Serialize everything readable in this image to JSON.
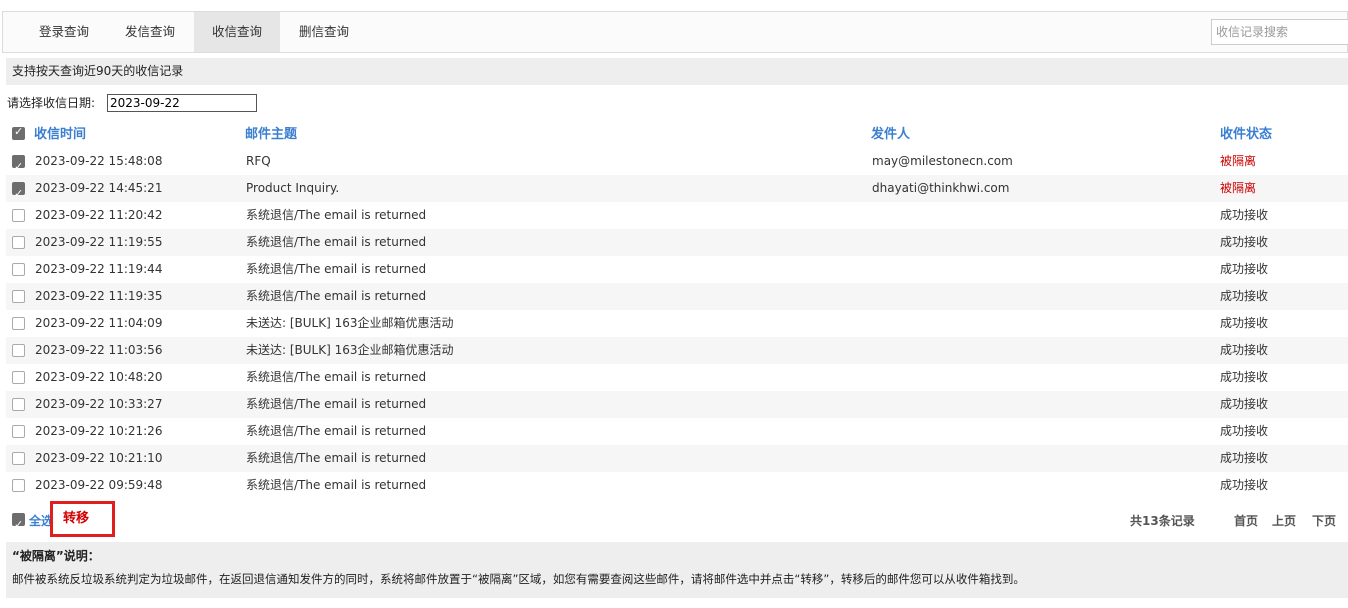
{
  "tabs": [
    {
      "label": "登录查询",
      "active": false
    },
    {
      "label": "发信查询",
      "active": false
    },
    {
      "label": "收信查询",
      "active": true
    },
    {
      "label": "删信查询",
      "active": false
    }
  ],
  "search": {
    "placeholder": "收信记录搜索"
  },
  "info": "支持按天查询近90天的收信记录",
  "date_filter": {
    "label": "请选择收信日期:",
    "value": "2023-09-22"
  },
  "table": {
    "headers": {
      "time": "收信时间",
      "subject": "邮件主题",
      "sender": "发件人",
      "status": "收件状态"
    },
    "rows": [
      {
        "checked": true,
        "time": "2023-09-22 15:48:08",
        "subject": "RFQ",
        "sender": "may@milestonecn.com",
        "status": "被隔离",
        "quarantined": true
      },
      {
        "checked": true,
        "time": "2023-09-22 14:45:21",
        "subject": "Product Inquiry.",
        "sender": "dhayati@thinkhwi.com",
        "status": "被隔离",
        "quarantined": true
      },
      {
        "checked": false,
        "time": "2023-09-22 11:20:42",
        "subject": "系统退信/The email is returned",
        "sender": "",
        "status": "成功接收",
        "quarantined": false
      },
      {
        "checked": false,
        "time": "2023-09-22 11:19:55",
        "subject": "系统退信/The email is returned",
        "sender": "",
        "status": "成功接收",
        "quarantined": false
      },
      {
        "checked": false,
        "time": "2023-09-22 11:19:44",
        "subject": "系统退信/The email is returned",
        "sender": "",
        "status": "成功接收",
        "quarantined": false
      },
      {
        "checked": false,
        "time": "2023-09-22 11:19:35",
        "subject": "系统退信/The email is returned",
        "sender": "",
        "status": "成功接收",
        "quarantined": false
      },
      {
        "checked": false,
        "time": "2023-09-22 11:04:09",
        "subject": "未送达: [BULK] 163企业邮箱优惠活动",
        "sender": "",
        "status": "成功接收",
        "quarantined": false
      },
      {
        "checked": false,
        "time": "2023-09-22 11:03:56",
        "subject": "未送达: [BULK] 163企业邮箱优惠活动",
        "sender": "",
        "status": "成功接收",
        "quarantined": false
      },
      {
        "checked": false,
        "time": "2023-09-22 10:48:20",
        "subject": "系统退信/The email is returned",
        "sender": "",
        "status": "成功接收",
        "quarantined": false
      },
      {
        "checked": false,
        "time": "2023-09-22 10:33:27",
        "subject": "系统退信/The email is returned",
        "sender": "",
        "status": "成功接收",
        "quarantined": false
      },
      {
        "checked": false,
        "time": "2023-09-22 10:21:26",
        "subject": "系统退信/The email is returned",
        "sender": "",
        "status": "成功接收",
        "quarantined": false
      },
      {
        "checked": false,
        "time": "2023-09-22 10:21:10",
        "subject": "系统退信/The email is returned",
        "sender": "",
        "status": "成功接收",
        "quarantined": false
      },
      {
        "checked": false,
        "time": "2023-09-22 09:59:48",
        "subject": "系统退信/The email is returned",
        "sender": "",
        "status": "成功接收",
        "quarantined": false
      }
    ]
  },
  "footer": {
    "select_all": "全选",
    "transfer": "转移",
    "total": "共13条记录",
    "first": "首页",
    "prev": "上页",
    "next": "下页"
  },
  "note": {
    "title": "“被隔离”说明：",
    "text": "邮件被系统反垃圾系统判定为垃圾邮件，在返回退信通知发件方的同时，系统将邮件放置于“被隔离”区域，如您有需要查阅这些邮件，请将邮件选中并点击“转移”，转移后的邮件您可以从收件箱找到。"
  },
  "colors": {
    "accent": "#3b7fd1",
    "quarantine": "#cc0000",
    "highlight_border": "#e01e1e"
  }
}
